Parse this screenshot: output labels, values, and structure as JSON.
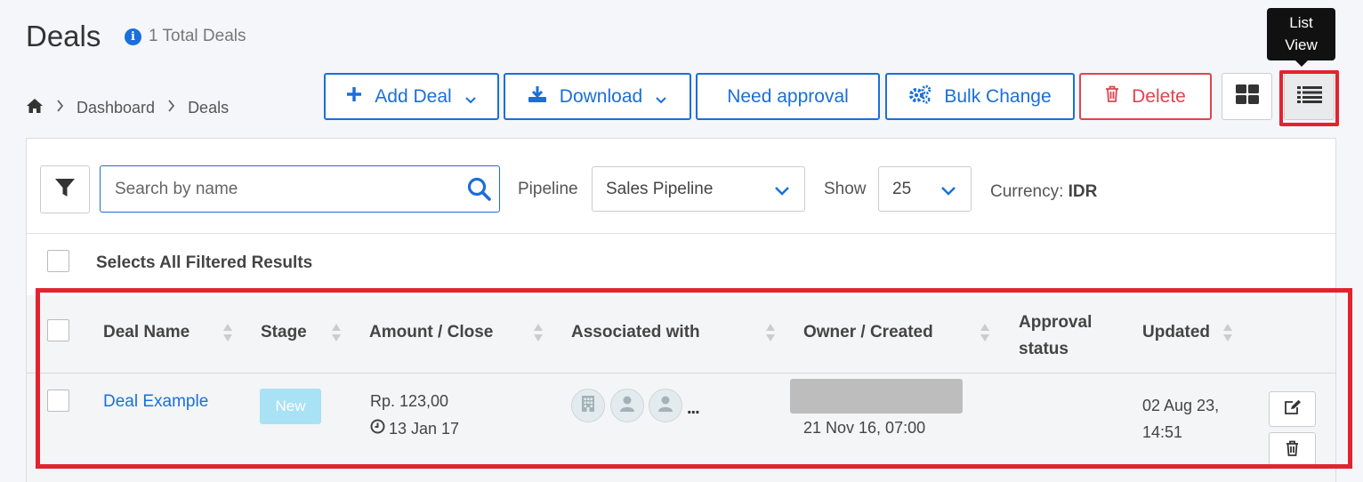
{
  "header": {
    "title": "Deals",
    "total": "1 Total Deals"
  },
  "breadcrumb": {
    "items": [
      "Dashboard",
      "Deals"
    ]
  },
  "toolbar": {
    "add_deal": "Add Deal",
    "download": "Download",
    "need_approval": "Need approval",
    "bulk_change": "Bulk Change",
    "delete": "Delete",
    "tooltip_line1": "List",
    "tooltip_line2": "View"
  },
  "filters": {
    "search_placeholder": "Search by name",
    "pipeline_label": "Pipeline",
    "pipeline_value": "Sales Pipeline",
    "show_label": "Show",
    "show_value": "25",
    "currency_label": "Currency:",
    "currency_value": "IDR"
  },
  "select_all": "Selects All Filtered Results",
  "table": {
    "columns": {
      "deal_name": "Deal Name",
      "stage": "Stage",
      "amount_close": "Amount / Close",
      "associated": "Associated with",
      "owner_created": "Owner / Created",
      "approval_line1": "Approval",
      "approval_line2": "status",
      "updated": "Updated"
    },
    "rows": [
      {
        "deal_name": "Deal Example",
        "stage": "New",
        "amount": "Rp. 123,00",
        "close_date": "13 Jan 17",
        "associated_more": "...",
        "created": "21 Nov 16, 07:00",
        "approval_status": "",
        "updated": "02 Aug 23, 14:51"
      }
    ]
  },
  "colors": {
    "primary": "#1a6fd9",
    "danger": "#e0434f",
    "highlight": "#e3232f",
    "stage_new": "#a9e1f5"
  }
}
